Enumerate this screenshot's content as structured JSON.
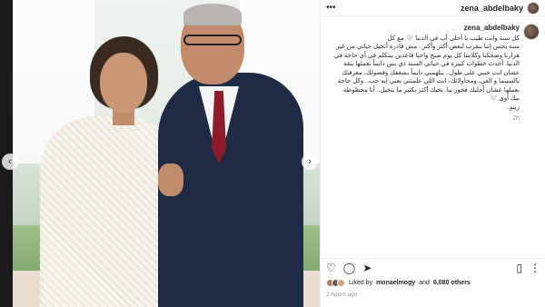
{
  "header": {
    "username": "zena_abdelbaky",
    "more_icon": "more-horizontal-icon"
  },
  "photo": {
    "prev_icon": "chevron-left-icon",
    "next_icon": "chevron-right-icon"
  },
  "caption": {
    "username": "zena_abdelbaky",
    "lines": [
      "كل سنة وانت طيب يا أحلى أب في الدنيا 🤍 مع كل",
      "سنة بحس إننا بنقرب لبعض أكتر وأكتر.. مش قادرة أتخيل حياتي من غير",
      "هزارنا وضحكنا وكلامنا كل يوم صبح واحنا قاعدين بنتكلم في أي حاجة في",
      "الدنيا. أحدث خطوات كبيرة في حياتي السنة دي بس دايماً بعملها بثقة",
      "عشان انت جنبي على طول.. بتلهمني دايماً بشغفك وفضولك، معرفتك",
      "بالسينما و الفن، ومحاولاتك، انت اللي علمتني يعني إيه حب.. وكل حاجة",
      "بعملها عشان أخليك فخور بيا. بحبك أكتر بكتير ما تتخيل.. أنا محظوظة",
      "بيك أوي 🤍",
      "زينو.."
    ],
    "age": "2h"
  },
  "actions": {
    "like_icon": "heart-icon",
    "comment_icon": "comment-icon",
    "share_icon": "send-icon",
    "save_icon": "bookmark-icon",
    "more_icon": "more-vertical-icon"
  },
  "likes": {
    "prefix": "Liked by",
    "user": "monaelmogy",
    "and": "and",
    "count": "6,080 others"
  },
  "timestamp": "2 hours ago"
}
